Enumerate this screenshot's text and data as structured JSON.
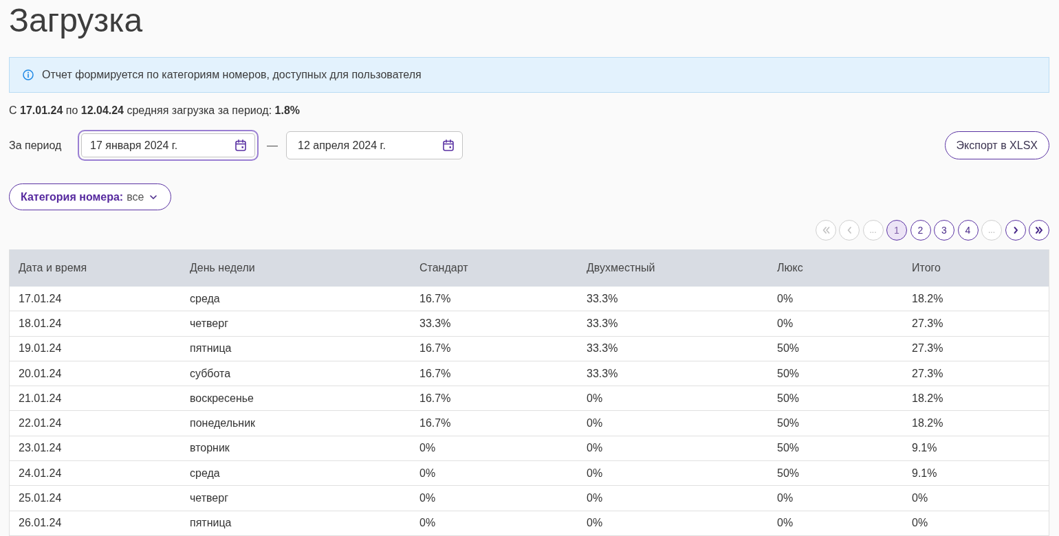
{
  "page": {
    "title": "Загрузка"
  },
  "notice": {
    "text": "Отчет формируется по категориям номеров, доступных для пользователя"
  },
  "summary": "С **17.01.24** по **12.04.24** средняя загрузка за период: **1.8%**",
  "period": {
    "label": "За период",
    "from": {
      "value": "17 января 2024 г.",
      "focused": true
    },
    "separator": "—",
    "to": {
      "value": "12 апреля 2024 г.",
      "focused": false
    }
  },
  "export_button": {
    "label": "Экспорт в XLSX"
  },
  "category_filter": {
    "label": "Категория номера:",
    "value": "все"
  },
  "pagination": [
    {
      "kind": "first",
      "disabled": true
    },
    {
      "kind": "prev",
      "disabled": true
    },
    {
      "kind": "ellipsis",
      "label": "..."
    },
    {
      "kind": "page",
      "label": "1",
      "selected": true
    },
    {
      "kind": "page",
      "label": "2",
      "selected": false
    },
    {
      "kind": "page",
      "label": "3",
      "selected": false
    },
    {
      "kind": "page",
      "label": "4",
      "selected": false
    },
    {
      "kind": "ellipsis",
      "label": "..."
    },
    {
      "kind": "next",
      "disabled": false
    },
    {
      "kind": "last",
      "disabled": false
    }
  ],
  "table": {
    "columns": [
      "Дата и время",
      "День недели",
      "Стандарт",
      "Двухместный",
      "Люкс",
      "Итого"
    ],
    "rows": [
      [
        "17.01.24",
        "среда",
        "16.7%",
        "33.3%",
        "0%",
        "18.2%"
      ],
      [
        "18.01.24",
        "четверг",
        "33.3%",
        "33.3%",
        "0%",
        "27.3%"
      ],
      [
        "19.01.24",
        "пятница",
        "16.7%",
        "33.3%",
        "50%",
        "27.3%"
      ],
      [
        "20.01.24",
        "суббота",
        "16.7%",
        "33.3%",
        "50%",
        "27.3%"
      ],
      [
        "21.01.24",
        "воскресенье",
        "16.7%",
        "0%",
        "50%",
        "18.2%"
      ],
      [
        "22.01.24",
        "понедельник",
        "16.7%",
        "0%",
        "50%",
        "18.2%"
      ],
      [
        "23.01.24",
        "вторник",
        "0%",
        "0%",
        "50%",
        "9.1%"
      ],
      [
        "24.01.24",
        "среда",
        "0%",
        "0%",
        "50%",
        "9.1%"
      ],
      [
        "25.01.24",
        "четверг",
        "0%",
        "0%",
        "0%",
        "0%"
      ],
      [
        "26.01.24",
        "пятница",
        "0%",
        "0%",
        "0%",
        "0%"
      ]
    ]
  }
}
